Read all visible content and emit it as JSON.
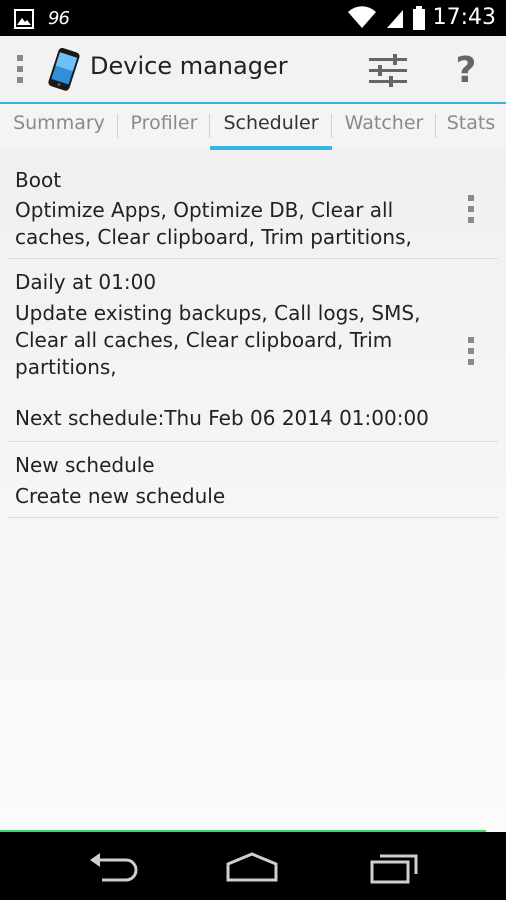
{
  "status_bar": {
    "notification_number": "96",
    "time": "17:43",
    "icons": [
      "image-icon",
      "wifi-icon",
      "signal-icon",
      "battery-icon"
    ]
  },
  "action_bar": {
    "title": "Device manager",
    "icons": [
      "overflow-dots-icon",
      "phone-app-icon",
      "tune-icon",
      "help-icon"
    ],
    "help_glyph": "?"
  },
  "tabs": [
    {
      "label": "Summary",
      "active": false
    },
    {
      "label": "Profiler",
      "active": false
    },
    {
      "label": "Scheduler",
      "active": true
    },
    {
      "label": "Watcher",
      "active": false
    },
    {
      "label": "Stats",
      "active": false
    }
  ],
  "schedules": [
    {
      "title": "Boot",
      "description": "Optimize Apps, Optimize DB, Clear all caches, Clear clipboard, Trim partitions,"
    },
    {
      "title": "Daily at 01:00",
      "description": "Update existing backups, Call logs, SMS, Clear all caches, Clear clipboard, Trim partitions,",
      "next_schedule": "Next schedule:Thu Feb 06 2014 01:00:00"
    },
    {
      "title": "New schedule",
      "description": "Create new schedule"
    }
  ],
  "colors": {
    "accent": "#33b5e5",
    "bottom_line": "#3cd36a"
  }
}
